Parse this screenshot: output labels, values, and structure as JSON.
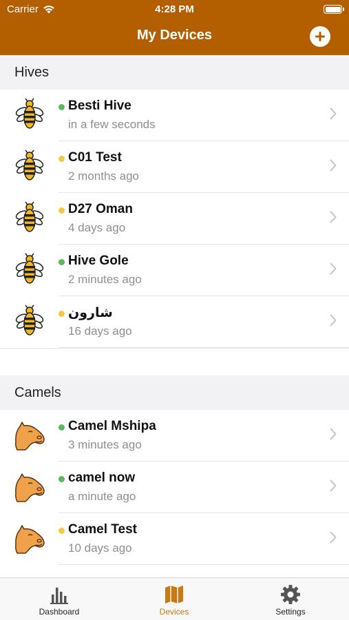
{
  "status": {
    "carrier": "Carrier",
    "time": "4:28 PM"
  },
  "nav": {
    "title": "My Devices"
  },
  "sections": [
    {
      "title": "Hives",
      "icon": "bee-icon",
      "items": [
        {
          "name": "Besti Hive",
          "time": "in a few seconds",
          "status": "online"
        },
        {
          "name": "C01 Test",
          "time": "2 months ago",
          "status": "warning"
        },
        {
          "name": "D27 Oman",
          "time": "4 days ago",
          "status": "warning"
        },
        {
          "name": "Hive Gole",
          "time": "2 minutes ago",
          "status": "online"
        },
        {
          "name": "شارون",
          "time": "16 days ago",
          "status": "warning"
        }
      ]
    },
    {
      "title": "Camels",
      "icon": "camel-icon",
      "items": [
        {
          "name": "Camel Mshipa",
          "time": "3 minutes ago",
          "status": "online"
        },
        {
          "name": "camel now",
          "time": "a minute ago",
          "status": "online"
        },
        {
          "name": "Camel Test",
          "time": "10 days ago",
          "status": "warning"
        }
      ]
    }
  ],
  "tabs": [
    {
      "label": "Dashboard",
      "icon": "bar-chart-icon",
      "active": false
    },
    {
      "label": "Devices",
      "icon": "map-icon",
      "active": true
    },
    {
      "label": "Settings",
      "icon": "gear-icon",
      "active": false
    }
  ],
  "colors": {
    "brand": "#b35f00",
    "online": "#5cb85c",
    "warning": "#f5c842",
    "tab_inactive": "#555555",
    "tab_active": "#c77a14"
  }
}
